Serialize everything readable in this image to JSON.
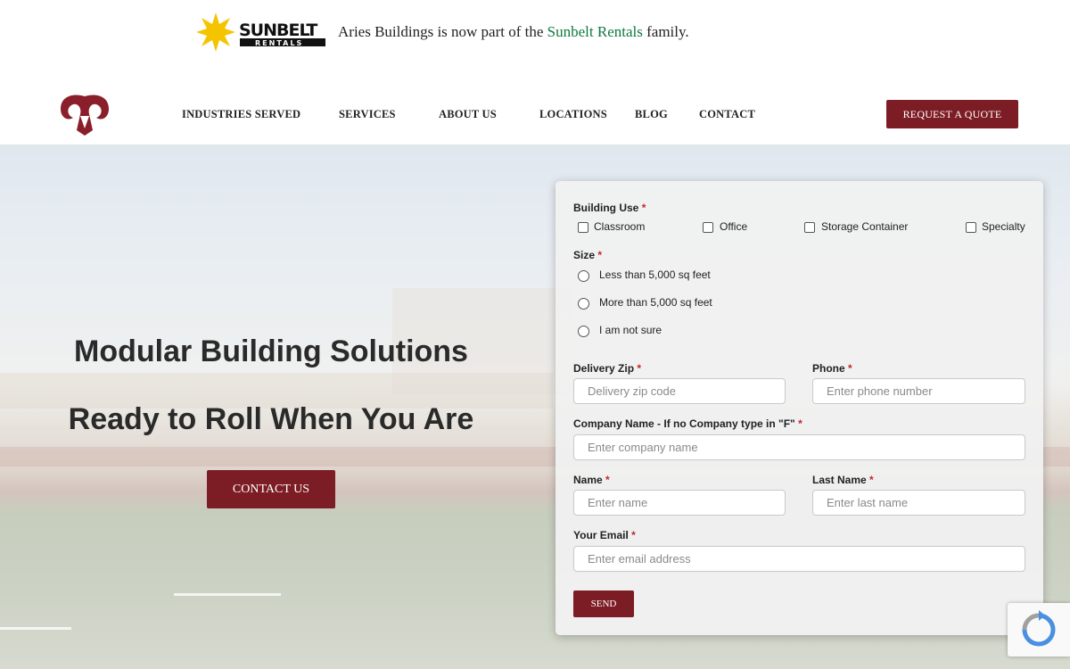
{
  "announcement": {
    "brand_logo": "SUNBELT RENTALS",
    "text_before": "Aries Buildings is now part of the",
    "link_text": "Sunbelt Rentals",
    "text_after": "family."
  },
  "nav": {
    "items": [
      {
        "label": "INDUSTRIES SERVED"
      },
      {
        "label": "SERVICES"
      },
      {
        "label": "ABOUT US"
      },
      {
        "label": "LOCATIONS"
      },
      {
        "label": "BLOG"
      },
      {
        "label": "CONTACT"
      }
    ],
    "quote_button": "REQUEST A QUOTE"
  },
  "hero": {
    "title": "Modular Building Solutions",
    "subtitle": "Ready to Roll When You Are",
    "cta": "CONTACT US"
  },
  "form": {
    "building_use": {
      "label": "Building Use",
      "required_mark": "*",
      "options": [
        "Classroom",
        "Office",
        "Storage Container",
        "Specialty"
      ]
    },
    "size": {
      "label": "Size",
      "required_mark": "*",
      "options": [
        "Less than 5,000 sq feet",
        "More than 5,000 sq feet",
        "I am not sure"
      ]
    },
    "delivery_zip": {
      "label": "Delivery Zip",
      "required_mark": "*",
      "placeholder": "Delivery zip code"
    },
    "phone": {
      "label": "Phone",
      "required_mark": "*",
      "placeholder": "Enter phone number"
    },
    "company": {
      "label": "Company Name - If no Company type in \"F\"",
      "required_mark": "*",
      "placeholder": "Enter company name"
    },
    "name": {
      "label": "Name",
      "required_mark": "*",
      "placeholder": "Enter name"
    },
    "last_name": {
      "label": "Last Name",
      "required_mark": "*",
      "placeholder": "Enter last name"
    },
    "email": {
      "label": "Your Email",
      "required_mark": "*",
      "placeholder": "Enter email address"
    },
    "send": "SEND"
  },
  "colors": {
    "brand_red": "#7c1c24",
    "link_green": "#0f7a3d",
    "sunbelt_yellow": "#f5c400",
    "required_red": "#c0282d"
  }
}
